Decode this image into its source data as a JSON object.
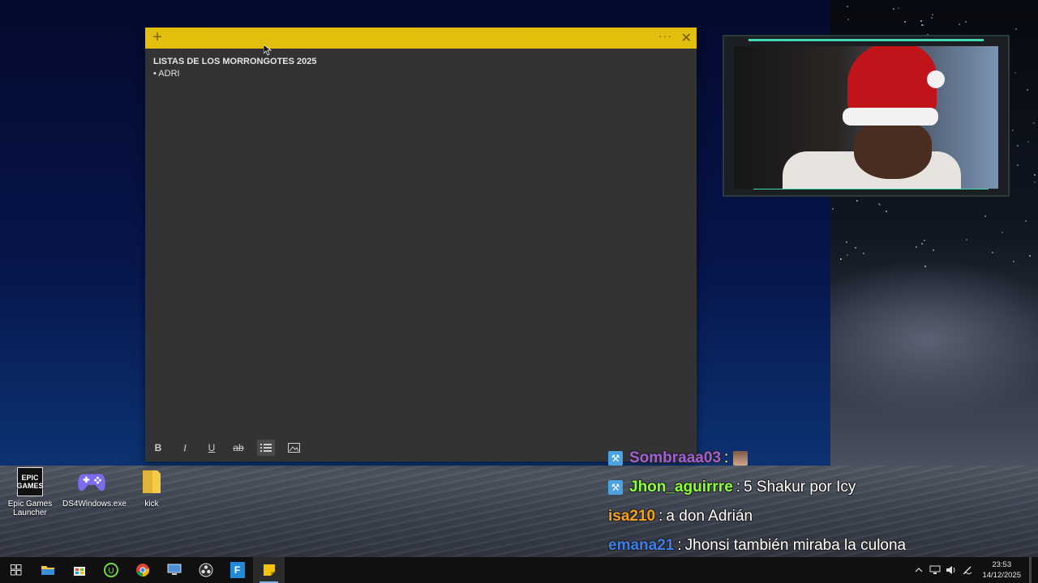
{
  "note": {
    "add_icon": "plus-icon",
    "menu_icon": "ellipsis-icon",
    "close_icon": "close-icon",
    "title": "LISTAS DE LOS MORRONGOTES 2025",
    "items": [
      "• ADRI"
    ],
    "bar_color": "#e2bf0c",
    "toolbar": {
      "bold": "B",
      "italic": "I",
      "underline": "U",
      "strike": "ab",
      "bullets_icon": "list-icon",
      "image_icon": "image-icon"
    }
  },
  "desktop_icons": [
    {
      "label": "Epic Games Launcher",
      "icon": "epic-games-icon"
    },
    {
      "label": "DS4Windows.exe",
      "icon": "gamepad-icon"
    },
    {
      "label": "kick",
      "icon": "folder-icon"
    }
  ],
  "chat": [
    {
      "user": "Sombraaa03",
      "color": "#a35fd6",
      "message": "",
      "badge": true,
      "emote": true
    },
    {
      "user": "Jhon_aguirrre",
      "color": "#8cff3a",
      "message": "5 Shakur por Icy",
      "badge": true,
      "emote": false
    },
    {
      "user": "isa210",
      "color": "#f5a21b",
      "message": "a don Adrián",
      "badge": false,
      "emote": false
    },
    {
      "user": "emana21",
      "color": "#3d7ee6",
      "message": "Jhonsi también miraba la culona",
      "badge": false,
      "emote": false
    }
  ],
  "taskbar": {
    "apps": [
      "windows-start-icon",
      "file-explorer-icon",
      "store-icon",
      "upwork-icon",
      "chrome-icon",
      "remote-desktop-icon",
      "obs-icon",
      "fortnite-icon",
      "sticky-notes-icon"
    ],
    "time": "23:53",
    "date": "14/12/2025"
  }
}
